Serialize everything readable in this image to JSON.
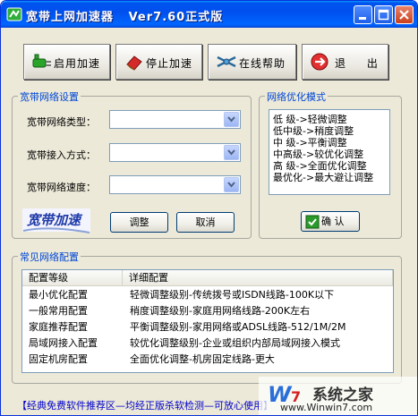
{
  "window": {
    "title": "宽带上网加速器   Ver7.60正式版",
    "colors": {
      "titlebar": "#0055e5",
      "group_title": "#0046d5",
      "link": "#0000cc"
    }
  },
  "toolbar": {
    "start_label": "启用加速",
    "stop_label": "停止加速",
    "help_label": "在线帮助",
    "exit_label": "退 出"
  },
  "settings": {
    "title": "宽带网络设置",
    "type_label": "宽带网络类型：",
    "access_label": "宽带接入方式：",
    "speed_label": "宽带网络速度：",
    "type_value": "",
    "access_value": "",
    "speed_value": "",
    "logo_text": "宽带加速",
    "adjust_label": "调整",
    "cancel_label": "取消"
  },
  "optimize": {
    "title": "网络优化模式",
    "options": [
      "低  级->轻微调整",
      "低中级->稍度调整",
      "中  级->平衡调整",
      "中高级->较优化调整",
      "高  级->全面优化调整",
      "最优化->最大避让调整"
    ],
    "confirm_label": "确 认"
  },
  "common": {
    "title": "常见网络配置",
    "headers": [
      "配置等级",
      "详细配置"
    ],
    "rows": [
      [
        "最小优化配置",
        "轻微调整级别-传统拨号或ISDN线路-100K以下"
      ],
      [
        "一般常用配置",
        "稍度调整级别-家庭用网络线路-200K左右"
      ],
      [
        "家庭推荐配置",
        "平衡调整级别-家用网络或ADSL线路-512/1M/2M"
      ],
      [
        "局域网接入配置",
        "较优化调整级别-企业或组织内部局域网接入模式"
      ],
      [
        "固定机房配置",
        "全面优化调整-机房固定线路-更大"
      ]
    ]
  },
  "footer": {
    "link_text": "【经典免费软件推荐区—均经正版杀软检测—可放心使用】"
  },
  "watermark": {
    "line1": "系统之家",
    "line2": "www.Winwin7.com"
  }
}
